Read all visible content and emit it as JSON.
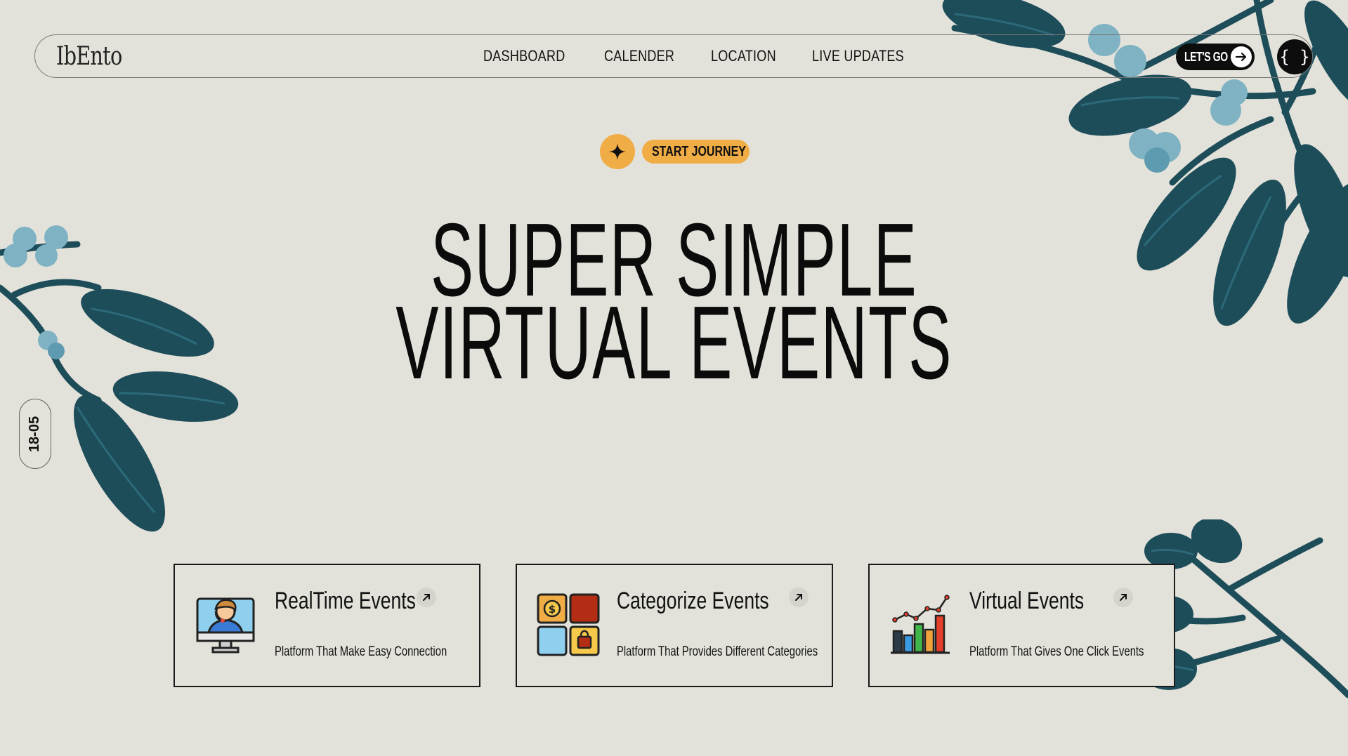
{
  "brand": {
    "logo_text": "IbEnto"
  },
  "nav": {
    "links": [
      "DASHBOARD",
      "CALENDER",
      "LOCATION",
      "LIVE UPDATES"
    ],
    "cta_label": "LET'S GO",
    "code_button_label": "{ }"
  },
  "hero": {
    "badge_label": "START JOURNEY",
    "title_line1": "SUPER SIMPLE",
    "title_line2": "VIRTUAL EVENTS"
  },
  "side_badge": {
    "text": "18-05"
  },
  "cards": [
    {
      "title": "RealTime Events",
      "description": "Platform That Make Easy Connection",
      "icon": "support-agent-computer-icon"
    },
    {
      "title": "Categorize Events",
      "description": "Platform That Provides Different Categories",
      "icon": "category-grid-icon"
    },
    {
      "title": "Virtual Events",
      "description": "Platform That Gives One Click Events",
      "icon": "bar-chart-growth-icon"
    }
  ],
  "colors": {
    "background": "#e3e2da",
    "accent": "#f0ac45",
    "leaf": "#1e4d5a",
    "berry": "#7fb2c3",
    "dark": "#0d0d0d"
  }
}
